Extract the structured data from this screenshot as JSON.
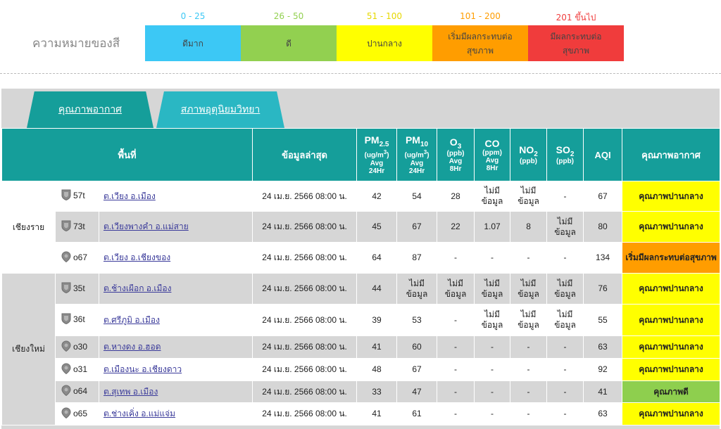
{
  "legend": {
    "title": "ความหมายของสี",
    "items": [
      {
        "range": "0 - 25",
        "label": "ดีมาก",
        "color": "#3cc8f5",
        "range_color": "#3cc8f5"
      },
      {
        "range": "26 - 50",
        "label": "ดี",
        "color": "#92d050",
        "range_color": "#92d050"
      },
      {
        "range": "51 - 100",
        "label": "ปานกลาง",
        "color": "#ffff00",
        "range_color": "#e6d800"
      },
      {
        "range": "101 - 200",
        "label": "เริ่มมีผลกระทบต่อสุขภาพ",
        "color": "#ff9d00",
        "range_color": "#ff9d00"
      },
      {
        "range": "201 ขึ้นไป",
        "label": "มีผลกระทบต่อสุขภาพ",
        "color": "#f03c3c",
        "range_color": "#f03c3c"
      }
    ]
  },
  "tabs": [
    {
      "label": "คุณภาพอากาศ",
      "active": true
    },
    {
      "label": "สภาพอุตุนิยมวิทยา",
      "active": false
    }
  ],
  "table": {
    "headers": {
      "area": "พื้นที่",
      "latest": "ข้อมูลล่าสุด",
      "pm25": {
        "name": "PM",
        "sub": "2.5",
        "unit": "(ug/m",
        "unit_sup": "3",
        "unit_end": ")",
        "avg": "Avg",
        "period": "24Hr"
      },
      "pm10": {
        "name": "PM",
        "sub": "10",
        "unit": "(ug/m",
        "unit_sup": "3",
        "unit_end": ")",
        "avg": "Avg",
        "period": "24Hr"
      },
      "o3": {
        "name": "O",
        "sub": "3",
        "unit": "(ppb)",
        "avg": "Avg",
        "period": "8Hr"
      },
      "co": {
        "name": "CO",
        "unit": "(ppm)",
        "avg": "Avg",
        "period": "8Hr"
      },
      "no2": {
        "name": "NO",
        "sub": "2",
        "unit": "(ppb)"
      },
      "so2": {
        "name": "SO",
        "sub": "2",
        "unit": "(ppb)"
      },
      "aqi": "AQI",
      "quality": "คุณภาพอากาศ"
    },
    "provinces": [
      {
        "name": "เชียงราย",
        "rows": [
          {
            "icon": "shield",
            "code": "57t",
            "area": "ต.เวียง อ.เมือง",
            "time": "24 เม.ย. 2566 08:00 น.",
            "pm25": "42",
            "pm10": "54",
            "o3": "28",
            "co": "ไม่มี ข้อมูล",
            "no2": "ไม่มี ข้อมูล",
            "so2": "-",
            "aqi": "67",
            "quality": "คุณภาพปานกลาง",
            "level": "moderate"
          },
          {
            "icon": "shield",
            "code": "73t",
            "area": "ต.เวียงพางคำ อ.แม่สาย",
            "time": "24 เม.ย. 2566 08:00 น.",
            "pm25": "45",
            "pm10": "67",
            "o3": "22",
            "co": "1.07",
            "no2": "8",
            "so2": "ไม่มี ข้อมูล",
            "aqi": "80",
            "quality": "คุณภาพปานกลาง",
            "level": "moderate"
          },
          {
            "icon": "pin",
            "code": "o67",
            "area": "ต.เวียง อ.เชียงของ",
            "time": "24 เม.ย. 2566 08:00 น.",
            "pm25": "64",
            "pm10": "87",
            "o3": "-",
            "co": "-",
            "no2": "-",
            "so2": "-",
            "aqi": "134",
            "quality": "เริ่มมีผลกระทบต่อสุขภาพ",
            "level": "unhealthy"
          }
        ]
      },
      {
        "name": "เชียงใหม่",
        "rows": [
          {
            "icon": "shield",
            "code": "35t",
            "area": "ต.ช้างเผือก อ.เมือง",
            "time": "24 เม.ย. 2566 08:00 น.",
            "pm25": "44",
            "pm10": "ไม่มี ข้อมูล",
            "o3": "ไม่มี ข้อมูล",
            "co": "ไม่มี ข้อมูล",
            "no2": "ไม่มี ข้อมูล",
            "so2": "ไม่มี ข้อมูล",
            "aqi": "76",
            "quality": "คุณภาพปานกลาง",
            "level": "moderate"
          },
          {
            "icon": "shield",
            "code": "36t",
            "area": "ต.ศรีภูมิ อ.เมือง",
            "time": "24 เม.ย. 2566 08:00 น.",
            "pm25": "39",
            "pm10": "53",
            "o3": "-",
            "co": "ไม่มี ข้อมูล",
            "no2": "ไม่มี ข้อมูล",
            "so2": "ไม่มี ข้อมูล",
            "aqi": "55",
            "quality": "คุณภาพปานกลาง",
            "level": "moderate"
          },
          {
            "icon": "pin",
            "code": "o30",
            "area": "ต.หางดง อ.ฮอด",
            "time": "24 เม.ย. 2566 08:00 น.",
            "pm25": "41",
            "pm10": "60",
            "o3": "-",
            "co": "-",
            "no2": "-",
            "so2": "-",
            "aqi": "63",
            "quality": "คุณภาพปานกลาง",
            "level": "moderate"
          },
          {
            "icon": "pin",
            "code": "o31",
            "area": "ต.เมืองนะ อ.เชียงดาว",
            "time": "24 เม.ย. 2566 08:00 น.",
            "pm25": "48",
            "pm10": "67",
            "o3": "-",
            "co": "-",
            "no2": "-",
            "so2": "-",
            "aqi": "92",
            "quality": "คุณภาพปานกลาง",
            "level": "moderate"
          },
          {
            "icon": "pin",
            "code": "o64",
            "area": "ต.สุเทพ อ.เมือง",
            "time": "24 เม.ย. 2566 08:00 น.",
            "pm25": "33",
            "pm10": "47",
            "o3": "-",
            "co": "-",
            "no2": "-",
            "so2": "-",
            "aqi": "41",
            "quality": "คุณภาพดี",
            "level": "good"
          },
          {
            "icon": "pin",
            "code": "o65",
            "area": "ต.ช่างเคิ่ง อ.แม่แจ่ม",
            "time": "24 เม.ย. 2566 08:00 น.",
            "pm25": "41",
            "pm10": "61",
            "o3": "-",
            "co": "-",
            "no2": "-",
            "so2": "-",
            "aqi": "63",
            "quality": "คุณภาพปานกลาง",
            "level": "moderate"
          }
        ]
      }
    ]
  }
}
